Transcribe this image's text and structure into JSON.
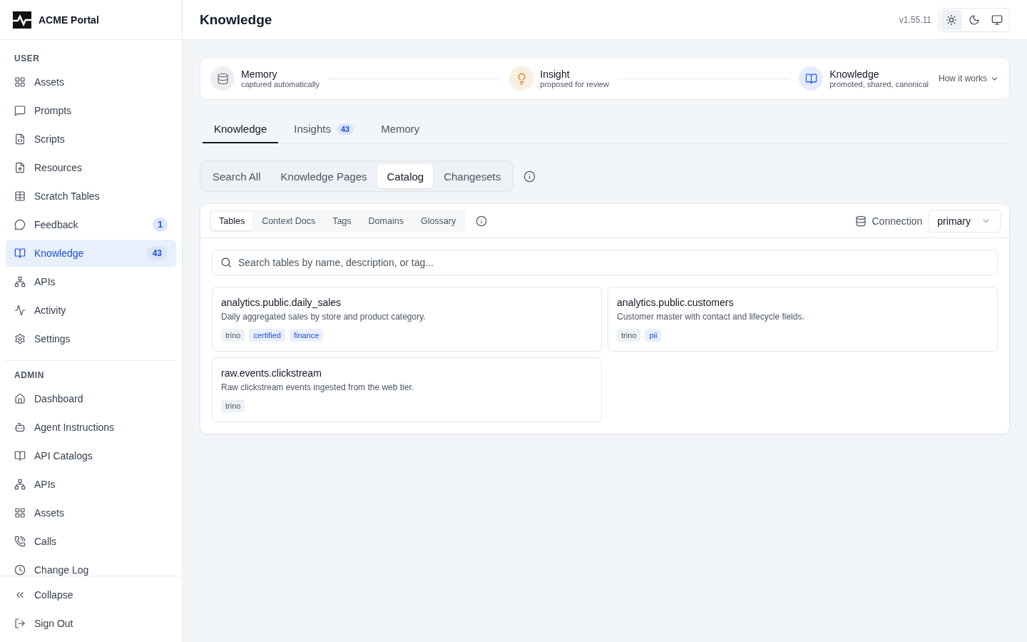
{
  "app": {
    "name": "ACME Portal"
  },
  "sidebar": {
    "sections": [
      {
        "heading": "USER",
        "items": [
          {
            "label": "Assets",
            "selected": false
          },
          {
            "label": "Prompts",
            "selected": false
          },
          {
            "label": "Scripts",
            "selected": false
          },
          {
            "label": "Resources",
            "selected": false
          },
          {
            "label": "Scratch Tables",
            "selected": false
          },
          {
            "label": "Feedback",
            "selected": false,
            "badge": "1"
          },
          {
            "label": "Knowledge",
            "selected": true,
            "badge": "43"
          },
          {
            "label": "APIs",
            "selected": false
          },
          {
            "label": "Activity",
            "selected": false
          },
          {
            "label": "Settings",
            "selected": false
          }
        ]
      },
      {
        "heading": "ADMIN",
        "items": [
          {
            "label": "Dashboard",
            "selected": false
          },
          {
            "label": "Agent Instructions",
            "selected": false
          },
          {
            "label": "API Catalogs",
            "selected": false
          },
          {
            "label": "APIs",
            "selected": false
          },
          {
            "label": "Assets",
            "selected": false
          },
          {
            "label": "Calls",
            "selected": false
          },
          {
            "label": "Change Log",
            "selected": false
          }
        ]
      }
    ],
    "footer": [
      "Collapse",
      "Sign Out"
    ]
  },
  "header": {
    "title": "Knowledge",
    "version": "v1.55.11",
    "theme_buttons": [
      {
        "selected": true
      },
      {
        "selected": false
      },
      {
        "selected": false
      }
    ]
  },
  "pipeline": {
    "steps": [
      {
        "title": "Memory",
        "subtitle": "captured automatically",
        "color": "#6b7280"
      },
      {
        "title": "Insight",
        "subtitle": "proposed for review",
        "color": "#d97706"
      },
      {
        "title": "Knowledge",
        "subtitle": "promoted, shared, canonical",
        "color": "#2563eb"
      }
    ],
    "link": "How it works"
  },
  "tabs": [
    {
      "label": "Knowledge",
      "selected": true
    },
    {
      "label": "Insights",
      "selected": false,
      "badge": "43"
    },
    {
      "label": "Memory",
      "selected": false
    }
  ],
  "views": [
    {
      "label": "Search All",
      "selected": false
    },
    {
      "label": "Knowledge Pages",
      "selected": false
    },
    {
      "label": "Catalog",
      "selected": true
    },
    {
      "label": "Changesets",
      "selected": false
    }
  ],
  "catalog": {
    "subtabs": [
      {
        "label": "Tables",
        "selected": true
      },
      {
        "label": "Context Docs",
        "selected": false
      },
      {
        "label": "Tags",
        "selected": false
      },
      {
        "label": "Domains",
        "selected": false
      },
      {
        "label": "Glossary",
        "selected": false
      }
    ],
    "connection_label": "Connection",
    "connection": "primary",
    "search": {
      "placeholder": "Search tables by name, description, or tag..."
    },
    "tables": [
      {
        "name": "analytics.public.daily_sales",
        "description": "Daily aggregated sales by store and product category.",
        "tags": [
          {
            "label": "trino",
            "kind": "source"
          },
          {
            "label": "certified",
            "kind": "tag"
          },
          {
            "label": "finance",
            "kind": "tag"
          }
        ]
      },
      {
        "name": "analytics.public.customers",
        "description": "Customer master with contact and lifecycle fields.",
        "tags": [
          {
            "label": "trino",
            "kind": "source"
          },
          {
            "label": "pii",
            "kind": "tag"
          }
        ]
      },
      {
        "name": "raw.events.clickstream",
        "description": "Raw clickstream events ingested from the web tier.",
        "tags": [
          {
            "label": "trino",
            "kind": "source"
          }
        ]
      }
    ]
  }
}
